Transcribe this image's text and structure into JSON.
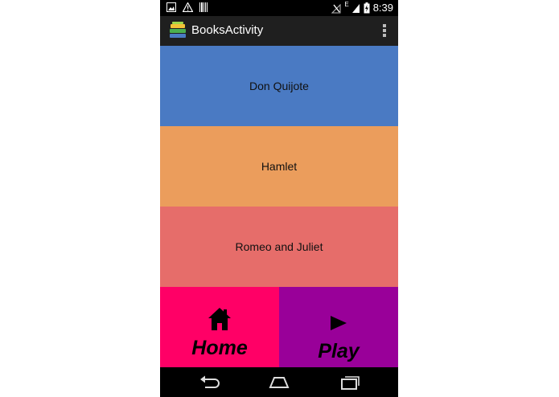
{
  "status_bar": {
    "time": "8:39",
    "left_icons": [
      "image-icon",
      "warning-icon",
      "barcode-icon"
    ],
    "right_icons": [
      "signal-off-icon",
      "network-e-icon",
      "battery-icon"
    ],
    "network_type": "E"
  },
  "action_bar": {
    "title": "BooksActivity",
    "logo_icon": "stacked-books-icon",
    "overflow_icon": "overflow-menu-icon"
  },
  "books": [
    {
      "title": "Don Quijote",
      "color": "#4a7ac3"
    },
    {
      "title": "Hamlet",
      "color": "#eb9d5c"
    },
    {
      "title": "Romeo and Juliet",
      "color": "#e66d6a"
    }
  ],
  "bottom_nav": {
    "home": {
      "label": "Home",
      "icon": "home-icon",
      "color": "#ff0066"
    },
    "play": {
      "label": "Play",
      "icon": "play-icon",
      "color": "#990099"
    }
  },
  "system_nav": {
    "icons": [
      "back-icon",
      "home-nav-icon",
      "recents-icon"
    ]
  }
}
